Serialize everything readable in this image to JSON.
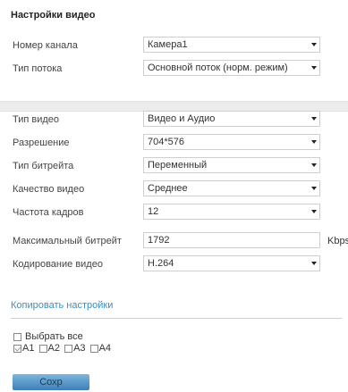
{
  "section_title": "Настройки видео",
  "fields": [
    {
      "label": "Номер канала",
      "value": "Камера1"
    },
    {
      "label": "Тип потока",
      "value": "Основной поток (норм. режим)"
    },
    {
      "label": "Тип видео",
      "value": "Видео и Аудио"
    },
    {
      "label": "Разрешение",
      "value": "704*576"
    },
    {
      "label": "Тип битрейта",
      "value": "Переменный"
    },
    {
      "label": "Качество видео",
      "value": "Среднее"
    },
    {
      "label": "Частота кадров",
      "value": "12"
    },
    {
      "label": "Максимальный битрейт",
      "value": "1792",
      "unit": "Kbps"
    },
    {
      "label": "Кодирование видео",
      "value": "H.264"
    }
  ],
  "copy_settings_link": "Копировать настройки",
  "select_all_label": "Выбрать все",
  "channels": [
    {
      "label": "A1",
      "checked": true
    },
    {
      "label": "A2",
      "checked": false
    },
    {
      "label": "A3",
      "checked": false
    },
    {
      "label": "A4",
      "checked": false
    }
  ],
  "save_button": "Сохр"
}
